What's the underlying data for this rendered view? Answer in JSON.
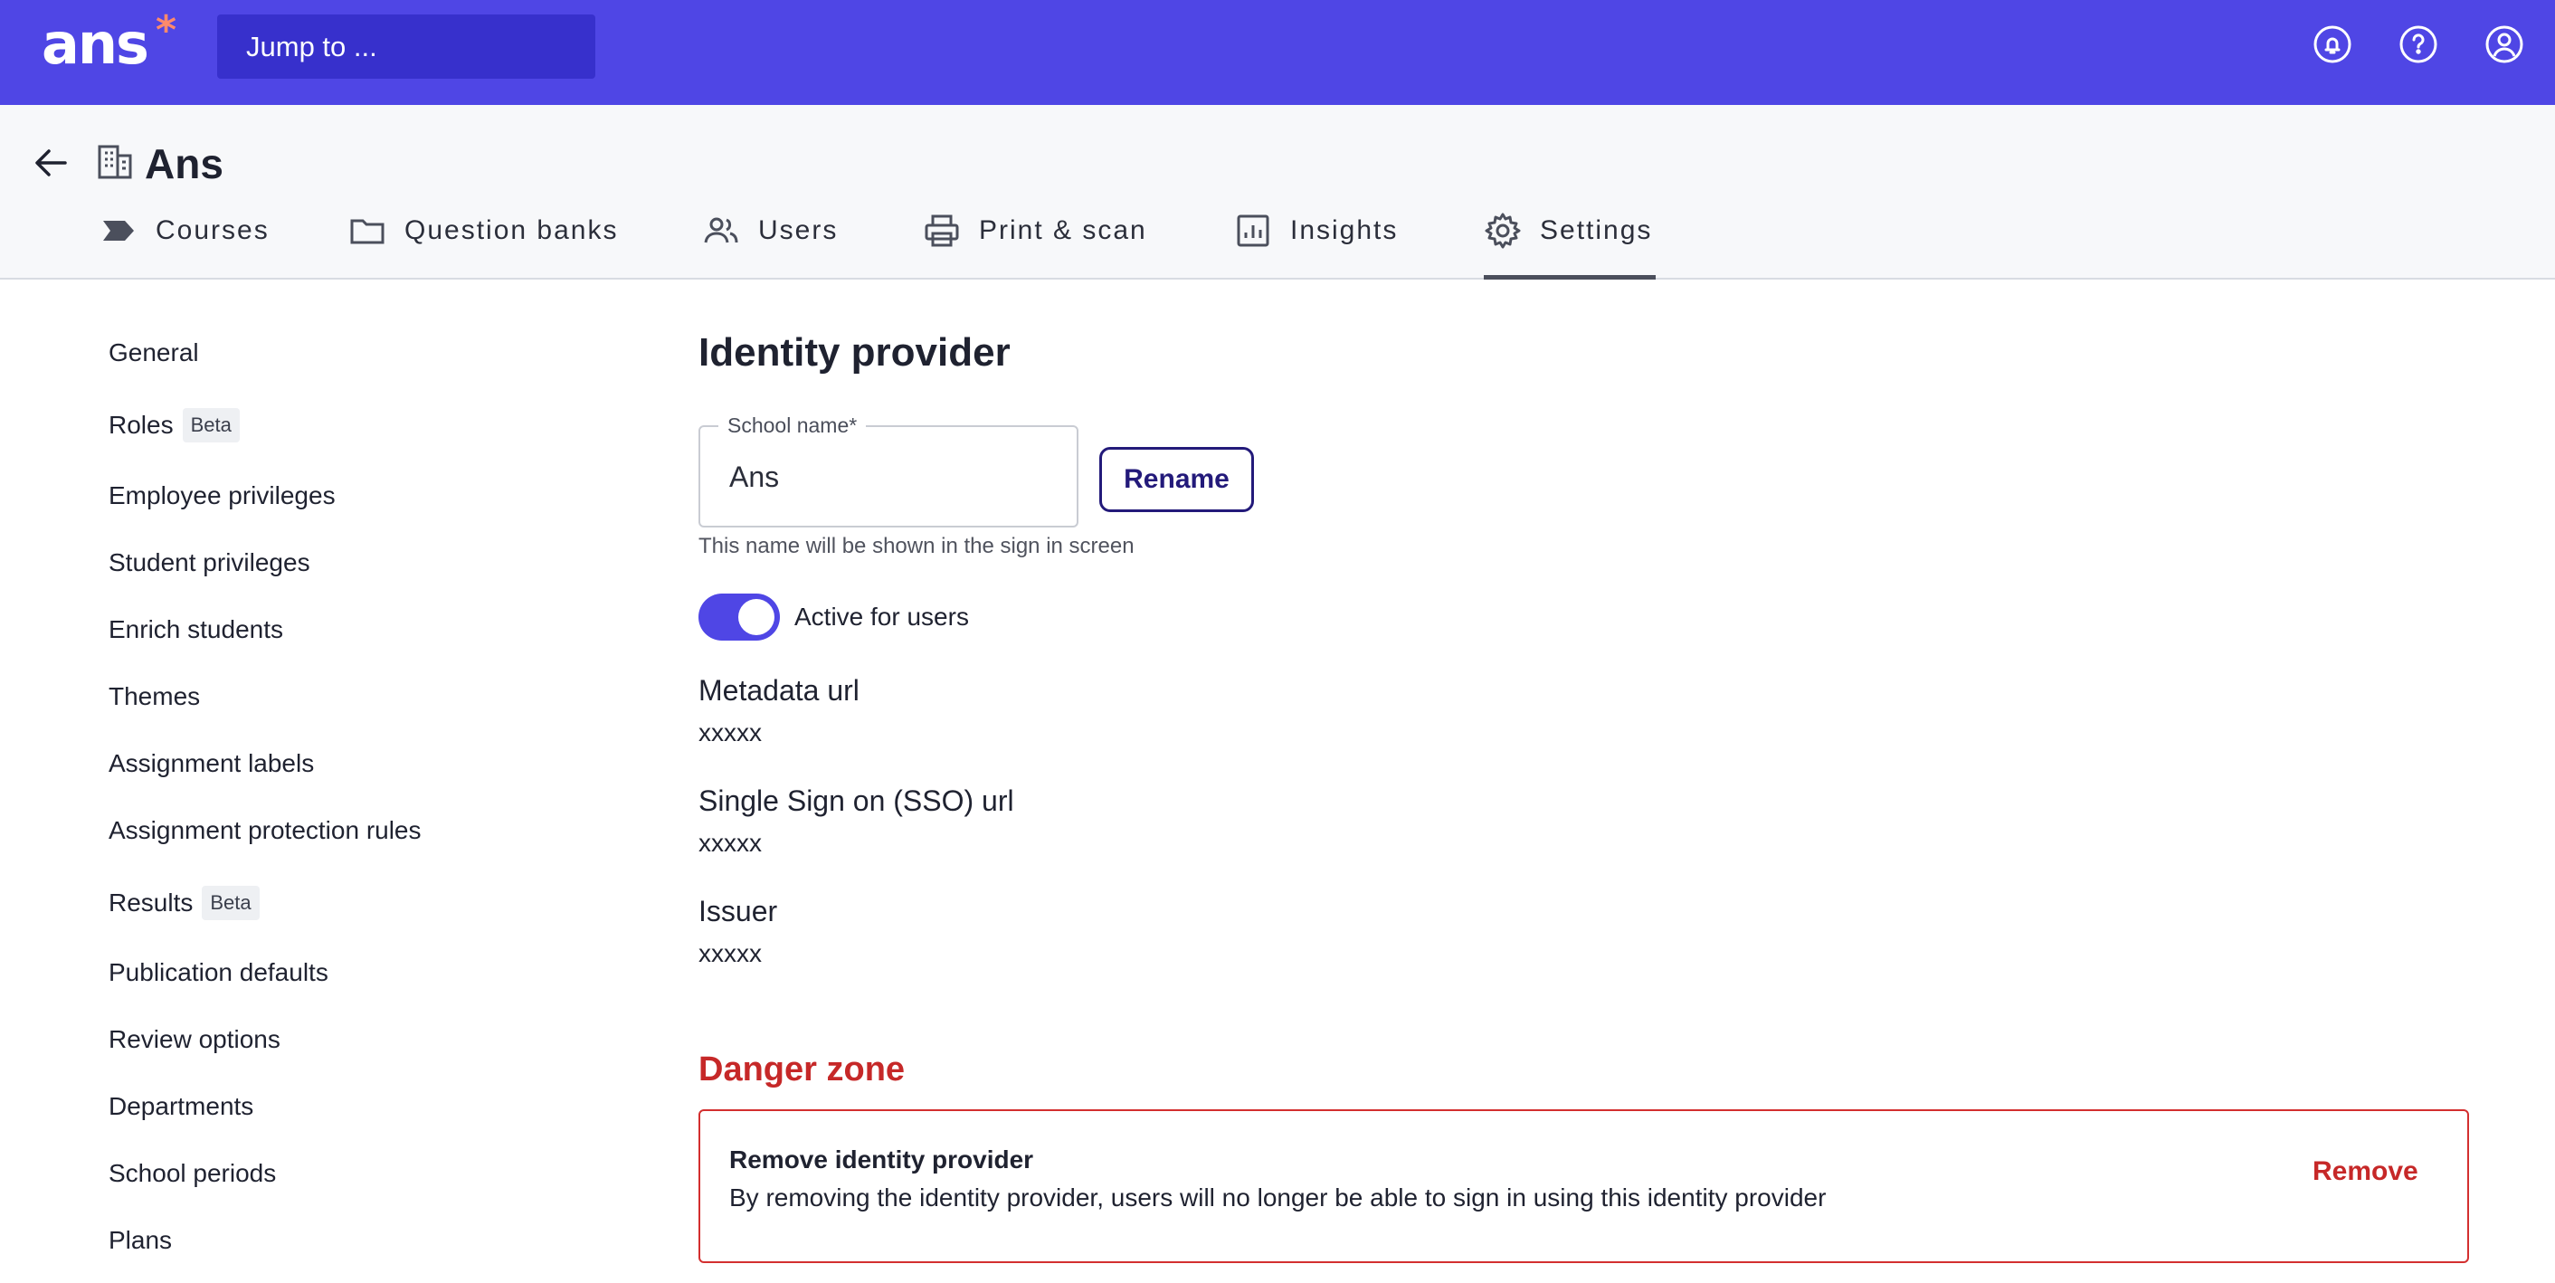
{
  "topbar": {
    "logo": "ans",
    "logo_star": "*",
    "jump_placeholder": "Jump to ...",
    "icons": [
      "notifications-icon",
      "help-icon",
      "account-icon"
    ]
  },
  "header": {
    "title": "Ans",
    "tabs": [
      {
        "label": "Courses",
        "icon": "courses-icon"
      },
      {
        "label": "Question banks",
        "icon": "folder-icon"
      },
      {
        "label": "Users",
        "icon": "users-icon"
      },
      {
        "label": "Print & scan",
        "icon": "printer-icon"
      },
      {
        "label": "Insights",
        "icon": "insights-icon"
      },
      {
        "label": "Settings",
        "icon": "gear-icon",
        "active": true
      }
    ]
  },
  "sidebar": {
    "items": [
      {
        "label": "General"
      },
      {
        "label": "Roles",
        "badge": "Beta"
      },
      {
        "label": "Employee privileges"
      },
      {
        "label": "Student privileges"
      },
      {
        "label": "Enrich students"
      },
      {
        "label": "Themes"
      },
      {
        "label": "Assignment labels"
      },
      {
        "label": "Assignment protection rules"
      },
      {
        "label": "Results",
        "badge": "Beta"
      },
      {
        "label": "Publication defaults"
      },
      {
        "label": "Review options"
      },
      {
        "label": "Departments"
      },
      {
        "label": "School periods"
      },
      {
        "label": "Plans"
      }
    ]
  },
  "main": {
    "title": "Identity provider",
    "school_name": {
      "label": "School name*",
      "value": "Ans",
      "hint": "This name will be shown in the sign in screen"
    },
    "rename_label": "Rename",
    "toggle": {
      "label": "Active for users",
      "on": true
    },
    "fields": [
      {
        "label": "Metadata url",
        "value": "xxxxx"
      },
      {
        "label": "Single Sign on (SSO) url",
        "value": "xxxxx"
      },
      {
        "label": "Issuer",
        "value": "xxxxx"
      }
    ],
    "danger": {
      "title": "Danger zone",
      "heading": "Remove identity provider",
      "description": "By removing the identity provider, users will no longer be able to sign in using this identity provider",
      "action": "Remove"
    }
  },
  "colors": {
    "brand": "#4f46e5",
    "danger": "#c62828"
  }
}
